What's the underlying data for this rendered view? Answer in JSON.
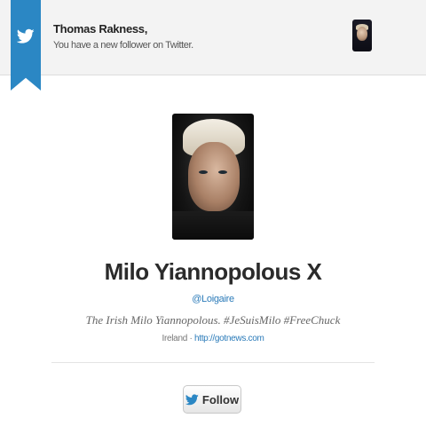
{
  "notification": {
    "greeting": "Thomas Rakness,",
    "message": "You have a new follower on Twitter."
  },
  "profile": {
    "display_name": "Milo Yiannopolous",
    "name_mark": "X",
    "handle": "@Loigaire",
    "bio": "The Irish Milo Yiannopolous. #JeSuisMilo #FreeChuck",
    "location": "Ireland",
    "separator": " · ",
    "url": "http://gotnews.com"
  },
  "follow_button": {
    "label": "Follow"
  },
  "colors": {
    "ribbon": "#2b87c4",
    "link": "#2b7bb9",
    "header_bg": "#f3f3f3"
  },
  "icons": {
    "ribbon": "twitter-bird-icon",
    "button": "twitter-bird-icon"
  }
}
